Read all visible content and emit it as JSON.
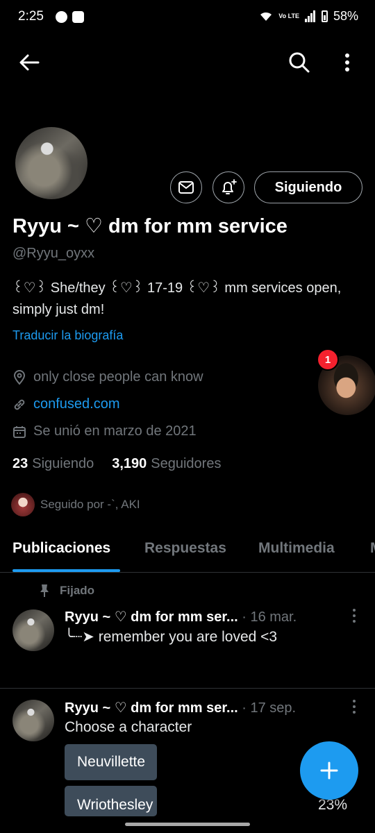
{
  "status_bar": {
    "time": "2:25",
    "battery": "58%",
    "network": "Vo LTE"
  },
  "nav": {
    "back_icon": "arrow-left-icon",
    "search_icon": "search-icon",
    "more_icon": "more-vertical-icon"
  },
  "profile": {
    "follow_button": "Siguiendo",
    "display_name": "Ryyu  ~ ♡ dm for mm service",
    "handle": "@Ryyu_oyxx",
    "bio_line1": "꒰♡꒱ She/they ꒰♡꒱ 17-19 ꒰♡꒱ mm services open,",
    "bio_line2": "simply just dm!",
    "translate": "Traducir la biografía",
    "location": "only close people can know",
    "website": "confused.com",
    "joined": "Se unió en marzo de 2021",
    "following_count": "23",
    "following_label": "Siguiendo",
    "followers_count": "3,190",
    "followers_label": "Seguidores",
    "followed_by": "Seguido por -`, AKI"
  },
  "bubble": {
    "badge": "1"
  },
  "tabs": [
    "Publicaciones",
    "Respuestas",
    "Multimedia",
    "M"
  ],
  "posts": [
    {
      "pinned_label": "Fijado",
      "name": "Ryyu  ~ ♡ dm for mm ser...",
      "date": "· 16 mar.",
      "text": "╰┈➤ remember you are loved <3"
    },
    {
      "name": "Ryyu  ~ ♡ dm for mm ser...",
      "date": "· 17 sep.",
      "text": "Choose a character",
      "poll": [
        {
          "label": "Neuvillette"
        },
        {
          "label": "Wriothesley",
          "percent": "23%"
        }
      ]
    }
  ],
  "colors": {
    "accent": "#1d9bf0",
    "background": "#000000",
    "muted": "#71767b",
    "badge": "#f4212e"
  }
}
